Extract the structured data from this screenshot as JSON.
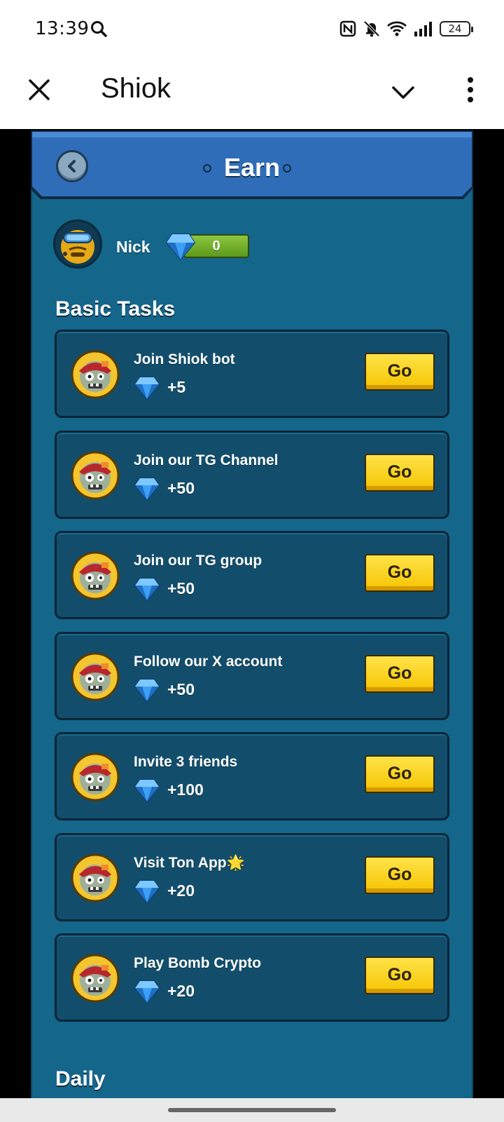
{
  "status_bar": {
    "time": "13:39",
    "battery": "24"
  },
  "app_bar": {
    "title": "Shiok"
  },
  "earn": {
    "title": "Earn"
  },
  "profile": {
    "name": "Nick",
    "gems": "0"
  },
  "sections": {
    "basic": "Basic Tasks",
    "daily": "Daily"
  },
  "tasks": [
    {
      "label": "Join Shiok bot",
      "reward": "+5",
      "button": "Go"
    },
    {
      "label": "Join our TG Channel",
      "reward": "+50",
      "button": "Go"
    },
    {
      "label": "Join our TG group",
      "reward": "+50",
      "button": "Go"
    },
    {
      "label": "Follow our X account",
      "reward": "+50",
      "button": "Go"
    },
    {
      "label": "Invite 3 friends",
      "reward": "+100",
      "button": "Go"
    },
    {
      "label": "Visit Ton App🌟",
      "reward": "+20",
      "button": "Go"
    },
    {
      "label": "Play Bomb Crypto",
      "reward": "+20",
      "button": "Go"
    }
  ],
  "colors": {
    "panel": "#14668a",
    "header": "#2f6db8",
    "card": "#124e6c",
    "go_button": "#f5c400",
    "gem_bar": "#6fae2a"
  }
}
